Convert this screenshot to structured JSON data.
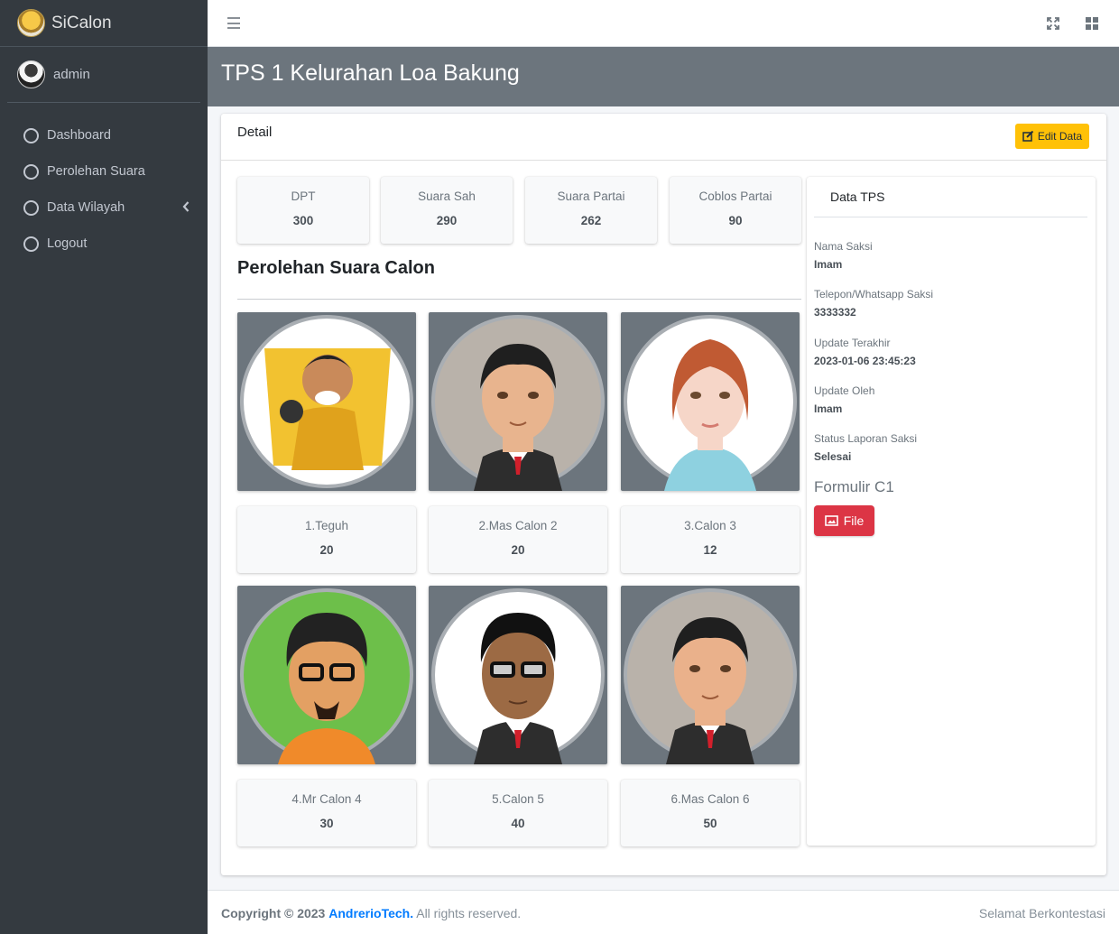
{
  "brand": {
    "name": "SiCalon"
  },
  "user": {
    "name": "admin"
  },
  "sidebar": {
    "items": [
      {
        "label": "Dashboard"
      },
      {
        "label": "Perolehan Suara"
      },
      {
        "label": "Data Wilayah"
      },
      {
        "label": "Logout"
      }
    ]
  },
  "page": {
    "title": "TPS 1 Kelurahan Loa Bakung"
  },
  "card": {
    "title": "Detail",
    "edit_label": "Edit Data"
  },
  "stats": [
    {
      "label": "DPT",
      "value": "300"
    },
    {
      "label": "Suara Sah",
      "value": "290"
    },
    {
      "label": "Suara Partai",
      "value": "262"
    },
    {
      "label": "Coblos Partai",
      "value": "90"
    }
  ],
  "section": {
    "title": "Perolehan Suara Calon"
  },
  "candidates": [
    {
      "name": "1.Teguh",
      "votes": "20",
      "bg": "#f2c230",
      "skin": "#c98a5a",
      "hair": "#222"
    },
    {
      "name": "2.Mas Calon 2",
      "votes": "20",
      "bg": "#b9b2aa",
      "skin": "#e8b48e",
      "hair": "#1f1f1f"
    },
    {
      "name": "3.Calon 3",
      "votes": "12",
      "bg": "#ffffff",
      "skin": "#f6d6c8",
      "hair": "#c05a33"
    },
    {
      "name": "4.Mr Calon 4",
      "votes": "30",
      "bg": "#6dbf4a",
      "skin": "#e3a063",
      "hair": "#222"
    },
    {
      "name": "5.Calon 5",
      "votes": "40",
      "bg": "#ffffff",
      "skin": "#9c6a44",
      "hair": "#111"
    },
    {
      "name": "6.Mas Calon 6",
      "votes": "50",
      "bg": "#b9b2aa",
      "skin": "#eab18b",
      "hair": "#1f1f1f"
    }
  ],
  "tps": {
    "title": "Data TPS",
    "fields": [
      {
        "label": "Nama Saksi",
        "value": "Imam"
      },
      {
        "label": "Telepon/Whatsapp Saksi",
        "value": "3333332"
      },
      {
        "label": "Update Terakhir",
        "value": "2023-01-06 23:45:23"
      },
      {
        "label": "Update Oleh",
        "value": "Imam"
      },
      {
        "label": "Status Laporan Saksi",
        "value": "Selesai"
      }
    ],
    "formulir": "Formulir C1",
    "file_label": "File"
  },
  "footer": {
    "copyright": "Copyright © 2023",
    "company": "AndrerioTech.",
    "rights": "All rights reserved.",
    "right_text": "Selamat Berkontestasi"
  }
}
